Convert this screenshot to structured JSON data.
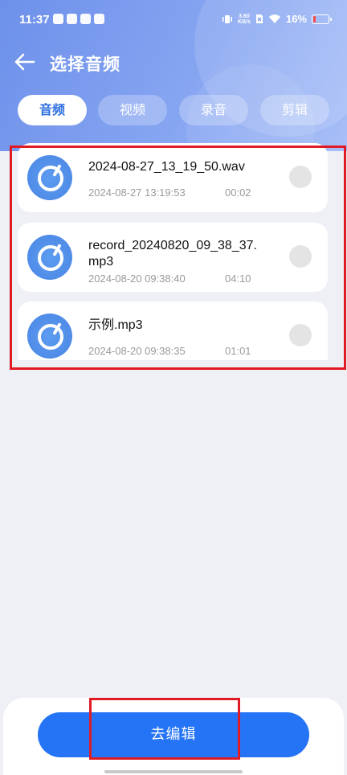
{
  "status": {
    "time": "11:37",
    "net_speed_value": "3.60",
    "net_speed_unit": "KB/s",
    "battery": "16%"
  },
  "header": {
    "title": "选择音频"
  },
  "tabs": [
    {
      "label": "音频",
      "active": true
    },
    {
      "label": "视频",
      "active": false
    },
    {
      "label": "录音",
      "active": false
    },
    {
      "label": "剪辑",
      "active": false
    }
  ],
  "files": [
    {
      "name": "2024-08-27_13_19_50.wav",
      "date": "2024-08-27 13:19:53",
      "duration": "00:02"
    },
    {
      "name": "record_20240820_09_38_37.mp3",
      "date": "2024-08-20 09:38:40",
      "duration": "04:10"
    },
    {
      "name": "示例.mp3",
      "date": "2024-08-20 09:38:35",
      "duration": "01:01"
    }
  ],
  "footer": {
    "edit_label": "去编辑"
  },
  "colors": {
    "accent": "#2474f5",
    "header_gradient_start": "#6d90ea",
    "annotation": "#e01b24"
  }
}
